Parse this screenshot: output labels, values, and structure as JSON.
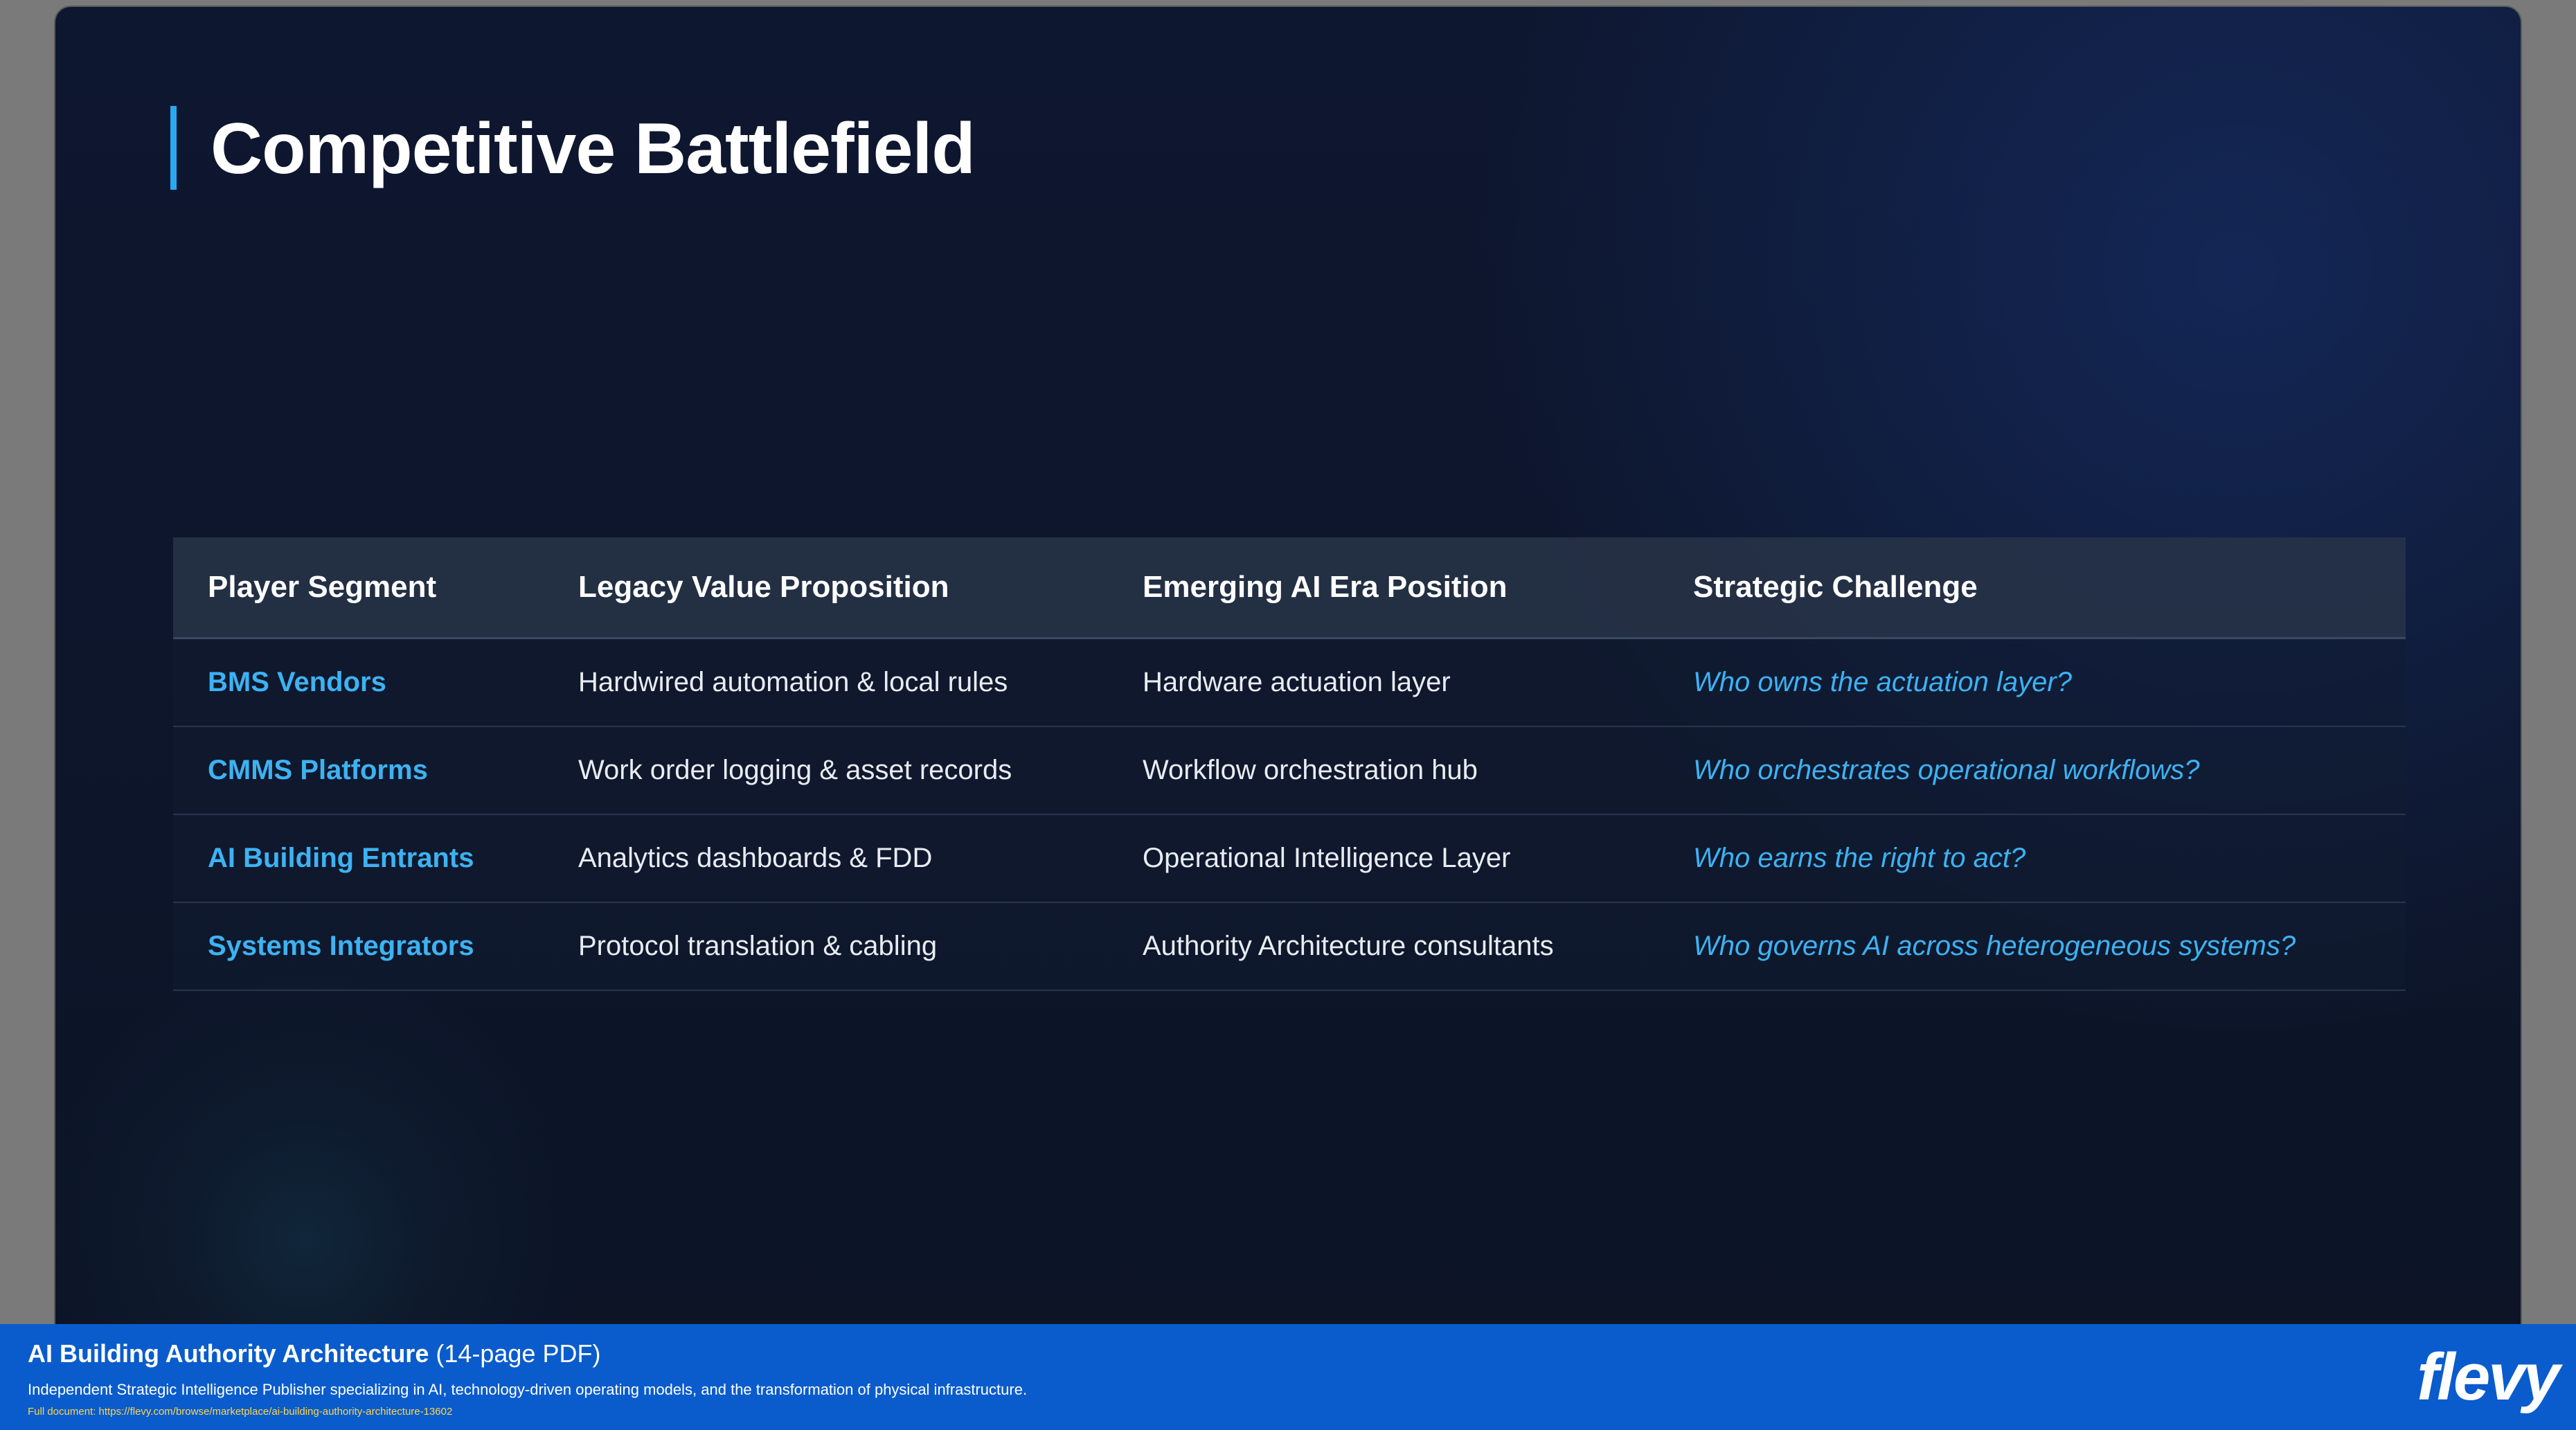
{
  "slide": {
    "title": "Competitive Battlefield"
  },
  "table": {
    "headers": [
      "Player Segment",
      "Legacy Value Proposition",
      "Emerging AI Era Position",
      "Strategic Challenge"
    ],
    "rows": [
      {
        "segment": "BMS Vendors",
        "legacy": "Hardwired automation & local rules",
        "emerging": "Hardware actuation layer",
        "challenge": "Who owns the actuation layer?"
      },
      {
        "segment": "CMMS Platforms",
        "legacy": "Work order logging & asset records",
        "emerging": "Workflow orchestration hub",
        "challenge": "Who orchestrates operational workflows?"
      },
      {
        "segment": "AI Building Entrants",
        "legacy": "Analytics dashboards & FDD",
        "emerging": "Operational Intelligence Layer",
        "challenge": "Who earns the right to act?"
      },
      {
        "segment": "Systems Integrators",
        "legacy": "Protocol translation & cabling",
        "emerging": "Authority Architecture consultants",
        "challenge": "Who governs AI across heterogeneous systems?"
      }
    ]
  },
  "footer": {
    "doc_title": "AI Building Authority Architecture",
    "doc_pages": " (14-page PDF)",
    "description": "Independent Strategic Intelligence Publisher specializing in AI, technology-driven operating models, and the transformation of physical infrastructure.",
    "link": "Full document: https://flevy.com/browse/marketplace/ai-building-authority-architecture-13602",
    "logo_text": "flevy"
  },
  "colors": {
    "accent": "#2aa8f0",
    "segment_text": "#3db2f2",
    "footer_bg": "#0a5ccc",
    "slide_bg": "#0d1527"
  }
}
